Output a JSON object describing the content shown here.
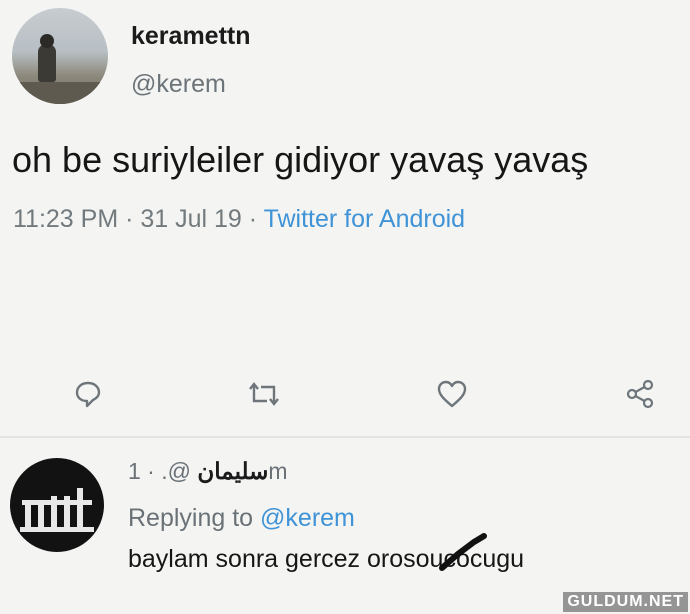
{
  "tweet": {
    "display_name": "keramettn",
    "handle": "@kerem",
    "text": "oh be suriyleiler gidiyor yavaş yavaş",
    "timestamp": "11:23 PM · 31 Jul 19 · ",
    "source": "Twitter for Android"
  },
  "actions": {
    "reply_icon": "comment-icon",
    "retweet_icon": "retweet-icon",
    "like_icon": "heart-icon",
    "share_icon": "share-icon"
  },
  "reply": {
    "display_name": "سليمان",
    "handle_time": "@. · 1m",
    "replying_label": "Replying to ",
    "replying_to": "@kerem",
    "text": "baylam sonra gercez orosoucocugu"
  },
  "watermark": "GULDUM.NET",
  "colors": {
    "link": "#3f93d6",
    "secondary_text": "#727a7e",
    "background": "#f4f5f3"
  }
}
